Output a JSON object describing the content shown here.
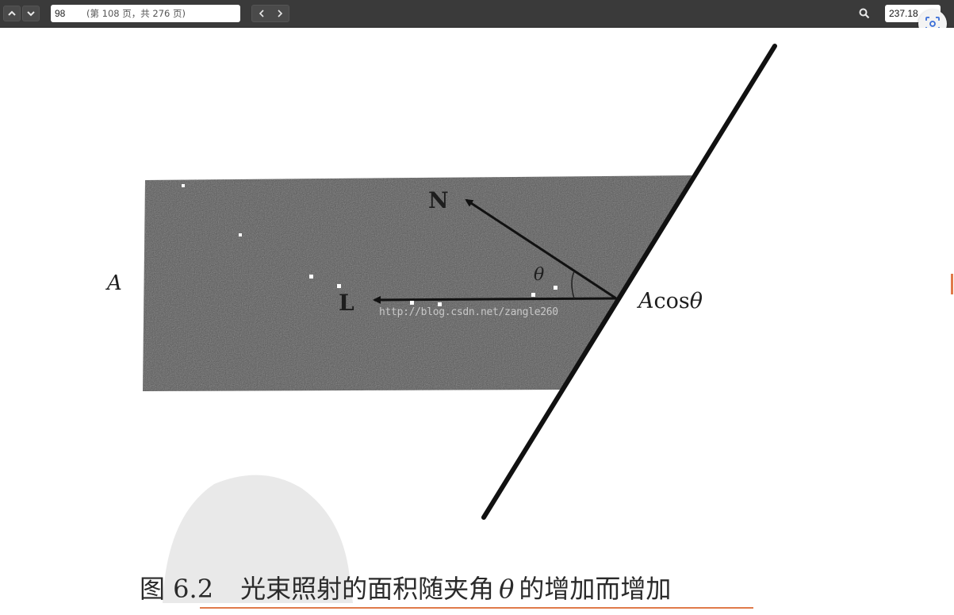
{
  "toolbar": {
    "page_number": "98",
    "page_info": "(第 108 页，共 276 页)",
    "zoom": "237.18",
    "icons": {
      "prev_page": "chevron-up-icon",
      "next_page": "chevron-down-icon",
      "back": "chevron-left-icon",
      "forward": "chevron-right-icon",
      "search": "search-icon",
      "zoom_dropdown": "chevron-down-icon",
      "screenshot": "screenshot-icon"
    }
  },
  "figure": {
    "label_a": "A",
    "label_n": "N",
    "label_l": "L",
    "label_theta": "θ",
    "label_acos_a": "A",
    "label_acos_rest": "cos",
    "label_acos_theta": "θ",
    "watermark": "http://blog.csdn.net/zangle260",
    "caption_number": "图 6.2",
    "caption_text_1": "光束照射的面积随夹角",
    "caption_theta": "θ",
    "caption_text_2": "的增加而增加"
  },
  "colors": {
    "toolbar_bg": "#3a3a3a",
    "beam_fill": "#555555",
    "ink": "#111111",
    "accent_orange": "#e07a4a"
  }
}
